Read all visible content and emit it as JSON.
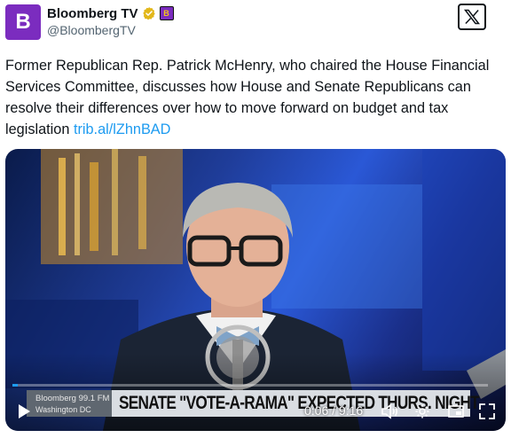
{
  "account": {
    "display_name": "Bloomberg TV",
    "handle": "@BloombergTV",
    "avatar_letter": "B",
    "affiliate_badge_letter": "B",
    "brand_color": "#7b2cbf"
  },
  "tweet": {
    "text": "Former Republican Rep. Patrick McHenry, who chaired the House Financial Services Committee, discusses how House and Senate Republicans can resolve their differences over how to move forward on budget and tax legislation ",
    "link": "trib.al/lZhnBAD"
  },
  "video": {
    "chyron_station": "Bloomberg 99.1 FM",
    "chyron_city": "Washington DC",
    "chyron_headline": "SENATE \"VOTE-A-RAMA\" EXPECTED THURS. NIGHT",
    "time_display": "0:06 / 9:16",
    "progress_fraction": 0.011,
    "icons": [
      "play-icon",
      "volume-icon",
      "settings-icon",
      "pip-icon",
      "fullscreen-icon"
    ]
  },
  "colors": {
    "link": "#1d9bf0",
    "verified": "#e2b719"
  }
}
